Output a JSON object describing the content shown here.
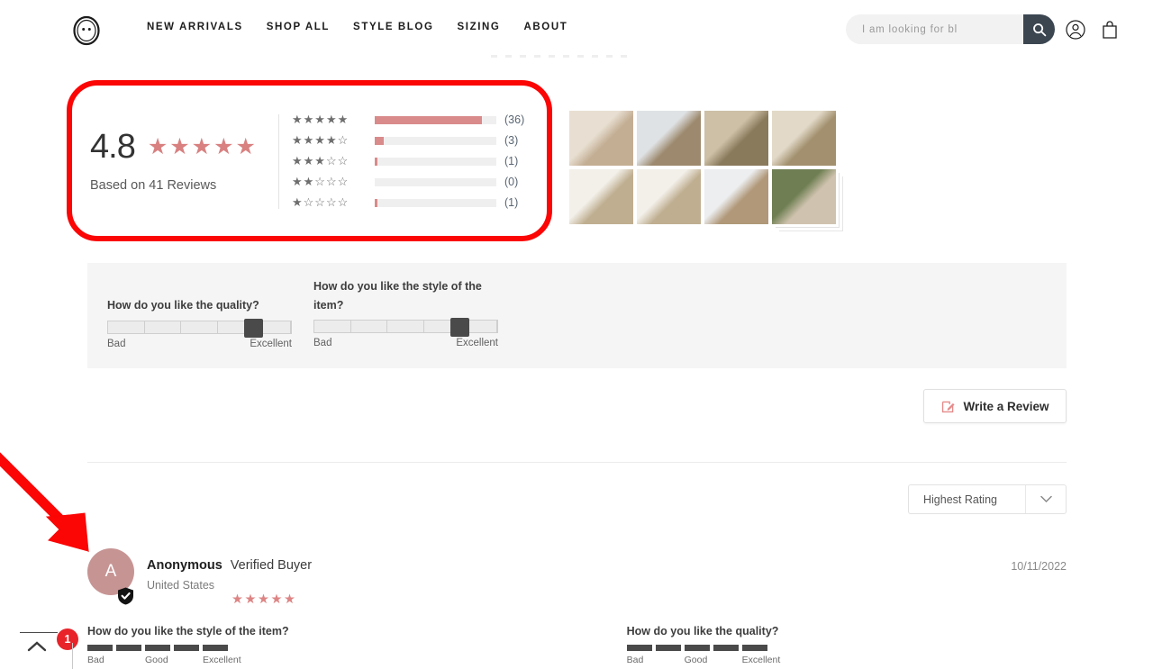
{
  "header": {
    "logo_name": "brand-logo",
    "nav": [
      {
        "label": "NEW ARRIVALS"
      },
      {
        "label": "SHOP ALL"
      },
      {
        "label": "STYLE BLOG"
      },
      {
        "label": "SIZING"
      },
      {
        "label": "ABOUT"
      }
    ],
    "search": {
      "placeholder": "I am looking for bl",
      "value": "",
      "button_icon": "search-icon"
    },
    "account_icon": "account-icon",
    "cart_icon": "shopping-bag-icon"
  },
  "summary": {
    "score": "4.8",
    "stars": "★★★★★",
    "based_on": "Based on 41 Reviews",
    "histogram": [
      {
        "stars": "★★★★★",
        "count": "(36)",
        "value": 36,
        "pct": 87.8
      },
      {
        "stars": "★★★★☆",
        "count": "(3)",
        "value": 3,
        "pct": 7.3
      },
      {
        "stars": "★★★☆☆",
        "count": "(1)",
        "value": 1,
        "pct": 2.4
      },
      {
        "stars": "★★☆☆☆",
        "count": "(0)",
        "value": 0,
        "pct": 0
      },
      {
        "stars": "★☆☆☆☆",
        "count": "(1)",
        "value": 1,
        "pct": 2.4
      }
    ],
    "bar_color": "#d98b8b",
    "star_color": "#d98080"
  },
  "photos": {
    "row1": [
      {
        "name": "review-photo-1",
        "c1": "#e8dfd2",
        "c2": "#c3ae93"
      },
      {
        "name": "review-photo-2",
        "c1": "#dfe2e4",
        "c2": "#9d8a6e"
      },
      {
        "name": "review-photo-3",
        "c1": "#cdc0a6",
        "c2": "#8a7a5c"
      },
      {
        "name": "review-photo-4",
        "c1": "#e2d9c8",
        "c2": "#a2906e"
      }
    ],
    "row2": [
      {
        "name": "review-photo-5",
        "c1": "#f3f0ea",
        "c2": "#bfae90"
      },
      {
        "name": "review-photo-6",
        "c1": "#f3f0ea",
        "c2": "#bfae90"
      },
      {
        "name": "review-photo-7",
        "c1": "#eceef0",
        "c2": "#b09878"
      },
      {
        "name": "review-photo-8",
        "c1": "#6f7f53",
        "c2": "#cfc2ae"
      }
    ]
  },
  "attributes_band": [
    {
      "title": "How do you like the quality?",
      "low": "Bad",
      "high": "Excellent",
      "knob_pct": 80
    },
    {
      "title": "How do you like the style of the item?",
      "low": "Bad",
      "high": "Excellent",
      "knob_pct": 80
    }
  ],
  "write_review": {
    "label": "Write a Review",
    "icon": "pencil-square-icon",
    "icon_color": "#e58a8a"
  },
  "sort": {
    "value": "Highest Rating",
    "caret_icon": "chevron-down-icon"
  },
  "review": {
    "avatar_initial": "A",
    "avatar_color": "#c79494",
    "verified_badge_icon": "verified-check-icon",
    "name": "Anonymous",
    "verified_text": "Verified Buyer",
    "location": "United States",
    "stars": "★★★★★",
    "date": "10/11/2022",
    "attributes": [
      {
        "title": "How do you like the style of the item?",
        "filled": 5,
        "total": 5,
        "scale": [
          "Bad",
          "Good",
          "Excellent"
        ]
      },
      {
        "title": "How do you like the quality?",
        "filled": 5,
        "total": 5,
        "scale": [
          "Bad",
          "Good",
          "Excellent"
        ]
      }
    ]
  },
  "bottom_widget": {
    "scroll_icon": "chevron-up-icon",
    "badge_count": "1",
    "badge_color": "#e8232a"
  },
  "annotations": {
    "highlight_box_color": "#fb0505",
    "arrow_color": "#fb0505",
    "arrow_name": "annotation-arrow",
    "box_name": "annotation-highlight-box"
  }
}
